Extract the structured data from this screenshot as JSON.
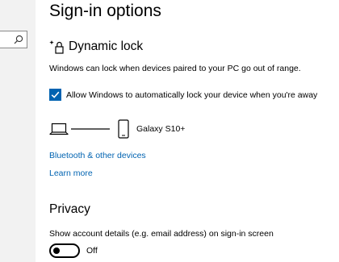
{
  "page": {
    "title": "Sign-in options"
  },
  "sidebar": {
    "search_icon": "search-icon"
  },
  "dynamic_lock": {
    "icon": "dynamic-lock-icon",
    "title": "Dynamic lock",
    "description": "Windows can lock when devices paired to your PC go out of range.",
    "checkbox_label": "Allow Windows to automatically lock your device when you're away",
    "checkbox_checked": true,
    "device_name": "Galaxy S10+",
    "links": {
      "bluetooth": "Bluetooth & other devices",
      "learn_more": "Learn more"
    }
  },
  "privacy": {
    "title": "Privacy",
    "description": "Show account details (e.g. email address) on sign-in screen",
    "toggle_state": "Off",
    "toggle_on": false
  },
  "colors": {
    "accent": "#0063b1",
    "sidebar_bg": "#f2f2f2"
  }
}
